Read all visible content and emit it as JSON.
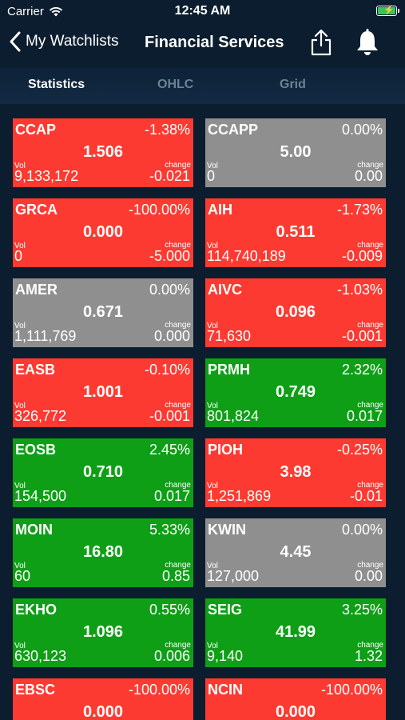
{
  "status_bar": {
    "carrier": "Carrier",
    "time": "12:45 AM",
    "battery_charging": true
  },
  "nav": {
    "back_label": "My Watchlists",
    "title": "Financial Services",
    "icons": [
      "chevron-left-icon",
      "share-icon",
      "bell-icon"
    ]
  },
  "tabs": [
    {
      "label": "Statistics",
      "active": true
    },
    {
      "label": "OHLC",
      "active": false
    },
    {
      "label": "Grid",
      "active": false
    }
  ],
  "tiles": [
    {
      "symbol": "CCAP",
      "pct": "-1.38%",
      "price": "1.506",
      "vol_label": "Vol",
      "volume": "9,133,172",
      "change_label": "change",
      "change": "-0.021",
      "color": "red"
    },
    {
      "symbol": "CCAPP",
      "pct": "0.00%",
      "price": "5.00",
      "vol_label": "Vol",
      "volume": "0",
      "change_label": "change",
      "change": "0.00",
      "color": "gray"
    },
    {
      "symbol": "GRCA",
      "pct": "-100.00%",
      "price": "0.000",
      "vol_label": "Vol",
      "volume": "0",
      "change_label": "change",
      "change": "-5.000",
      "color": "red"
    },
    {
      "symbol": "AIH",
      "pct": "-1.73%",
      "price": "0.511",
      "vol_label": "Vol",
      "volume": "114,740,189",
      "change_label": "change",
      "change": "-0.009",
      "color": "red"
    },
    {
      "symbol": "AMER",
      "pct": "0.00%",
      "price": "0.671",
      "vol_label": "Vol",
      "volume": "1,111,769",
      "change_label": "change",
      "change": "0.000",
      "color": "gray"
    },
    {
      "symbol": "AIVC",
      "pct": "-1.03%",
      "price": "0.096",
      "vol_label": "Vol",
      "volume": "71,630",
      "change_label": "change",
      "change": "-0.001",
      "color": "red"
    },
    {
      "symbol": "EASB",
      "pct": "-0.10%",
      "price": "1.001",
      "vol_label": "Vol",
      "volume": "326,772",
      "change_label": "change",
      "change": "-0.001",
      "color": "red"
    },
    {
      "symbol": "PRMH",
      "pct": "2.32%",
      "price": "0.749",
      "vol_label": "Vol",
      "volume": "801,824",
      "change_label": "change",
      "change": "0.017",
      "color": "green"
    },
    {
      "symbol": "EOSB",
      "pct": "2.45%",
      "price": "0.710",
      "vol_label": "Vol",
      "volume": "154,500",
      "change_label": "change",
      "change": "0.017",
      "color": "green"
    },
    {
      "symbol": "PIOH",
      "pct": "-0.25%",
      "price": "3.98",
      "vol_label": "Vol",
      "volume": "1,251,869",
      "change_label": "change",
      "change": "-0.01",
      "color": "red"
    },
    {
      "symbol": "MOIN",
      "pct": "5.33%",
      "price": "16.80",
      "vol_label": "Vol",
      "volume": "60",
      "change_label": "change",
      "change": "0.85",
      "color": "green"
    },
    {
      "symbol": "KWIN",
      "pct": "0.00%",
      "price": "4.45",
      "vol_label": "Vol",
      "volume": "127,000",
      "change_label": "change",
      "change": "0.00",
      "color": "gray"
    },
    {
      "symbol": "EKHO",
      "pct": "0.55%",
      "price": "1.096",
      "vol_label": "Vol",
      "volume": "630,123",
      "change_label": "change",
      "change": "0.006",
      "color": "green"
    },
    {
      "symbol": "SEIG",
      "pct": "3.25%",
      "price": "41.99",
      "vol_label": "Vol",
      "volume": "9,140",
      "change_label": "change",
      "change": "1.32",
      "color": "green"
    },
    {
      "symbol": "EBSC",
      "pct": "-100.00%",
      "price": "0.000",
      "vol_label": "Vol",
      "volume": "",
      "change_label": "change",
      "change": "",
      "color": "red"
    },
    {
      "symbol": "NCIN",
      "pct": "-100.00%",
      "price": "0.000",
      "vol_label": "Vol",
      "volume": "",
      "change_label": "change",
      "change": "",
      "color": "red"
    }
  ],
  "colors": {
    "red": "#fd3a31",
    "gray": "#8f8f8f",
    "green": "#0e9f16",
    "background": "#0b1d2e"
  }
}
